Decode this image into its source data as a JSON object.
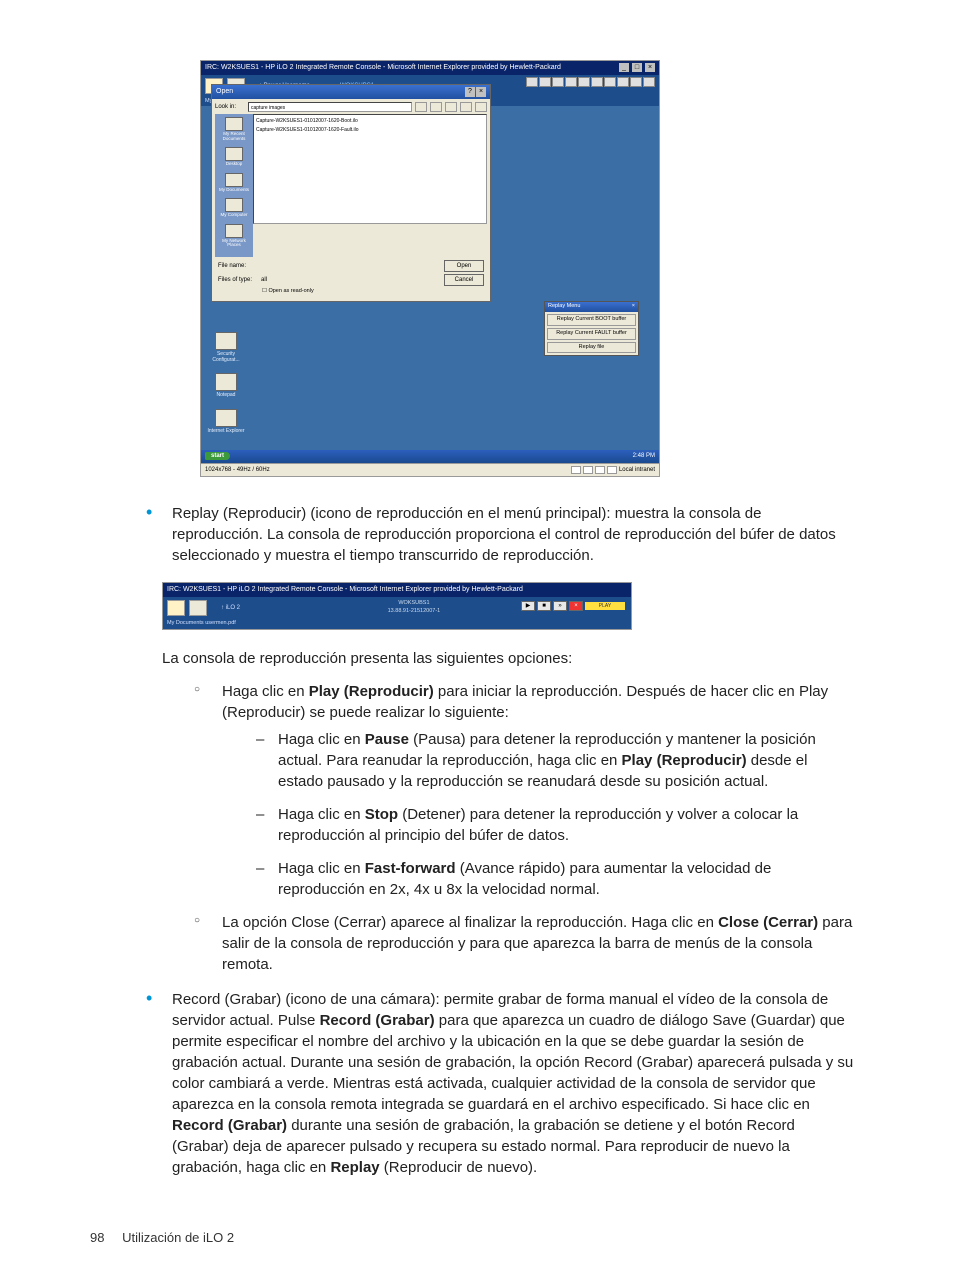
{
  "shot1": {
    "titlebar": "IRC: W2KSUES1 - HP iLO 2 Integrated Remote Console - Microsoft Internet Explorer provided by Hewlett-Packard",
    "toolbar_label": "WOKSUBS1",
    "toolbar_sub": "Power Username",
    "mydocs": "My Documents  usermen.pdf",
    "desktop_icons": [
      "Security Configurat...",
      "Notepad",
      "Internet Explorer"
    ],
    "open_dialog": {
      "title": "Open",
      "lookin_label": "Look in:",
      "lookin_value": "capture images",
      "files": [
        "Capture-W2KSUES1-01012007-1620-Boot.ilo",
        "Capture-W2KSUES1-01012007-1620-Fault.ilo"
      ],
      "places": [
        "My Recent Documents",
        "Desktop",
        "My Documents",
        "My Computer",
        "My Network Places"
      ],
      "filename_label": "File name:",
      "filename_value": "",
      "filetype_label": "Files of type:",
      "filetype_value": "all",
      "readonly": "Open as read-only",
      "open_btn": "Open",
      "cancel_btn": "Cancel"
    },
    "replay_menu": {
      "title": "Replay Menu",
      "items": [
        "Replay Current BOOT buffer",
        "Replay Current FAULT buffer",
        "Replay file"
      ]
    },
    "taskbar": {
      "start": "start",
      "right": "2:48 PM"
    },
    "status": {
      "left": "1024x768 - 49Hz / 60Hz",
      "right": "Local intranet"
    }
  },
  "bullets": {
    "replay": {
      "pre": "Replay (Reproducir) (icono de reproducción en el menú principal): muestra la consola de reproducción. La consola de reproducción proporciona el control de reproducción del búfer de datos seleccionado y muestra el tiempo transcurrido de reproducción."
    },
    "record": {
      "t1": "Record (Grabar) (icono de una cámara): permite grabar de forma manual el vídeo de la consola de servidor actual. Pulse ",
      "b1": "Record (Grabar)",
      "t2": " para que aparezca un cuadro de diálogo Save (Guardar) que permite especificar el nombre del archivo y la ubicación en la que se debe guardar la sesión de grabación actual. Durante una sesión de grabación, la opción Record (Grabar) aparecerá pulsada y su color cambiará a verde. Mientras está activada, cualquier actividad de la consola de servidor que aparezca en la consola remota integrada se guardará en el archivo especificado. Si hace clic en ",
      "b2": "Record (Grabar)",
      "t3": " durante una sesión de grabación, la grabación se detiene y el botón Record (Grabar) deja de aparecer pulsado y recupera su estado normal. Para reproducir de nuevo la grabación, haga clic en ",
      "b3": "Replay",
      "t4": " (Reproducir de nuevo)."
    }
  },
  "shot2": {
    "titlebar": "IRC: W2KSUES1 - HP iLO 2 Integrated Remote Console - Microsoft Internet Explorer provided by Hewlett-Packard",
    "label1": "WOKSUBS1",
    "label2": "13.88.91-21512007-1",
    "mydocs": "My Documents  usermen.pdf",
    "time": "PLAY"
  },
  "subintro": "La consola de reproducción presenta las siguientes opciones:",
  "circle1": {
    "t1": "Haga clic en ",
    "b1": "Play (Reproducir)",
    "t2": " para iniciar la reproducción. Después de hacer clic en Play (Reproducir) se puede realizar lo siguiente:"
  },
  "dash": {
    "d1": {
      "t1": "Haga clic en ",
      "b1": "Pause",
      "t2": " (Pausa) para detener la reproducción y mantener la posición actual. Para reanudar la reproducción, haga clic en ",
      "b2": "Play (Reproducir)",
      "t3": " desde el estado pausado y la reproducción se reanudará desde su posición actual."
    },
    "d2": {
      "t1": "Haga clic en ",
      "b1": "Stop",
      "t2": " (Detener) para detener la reproducción y volver a colocar la reproducción al principio del búfer de datos."
    },
    "d3": {
      "t1": "Haga clic en ",
      "b1": "Fast-forward",
      "t2": " (Avance rápido) para aumentar la velocidad de reproducción en 2x, 4x u 8x la velocidad normal."
    }
  },
  "circle2": {
    "t1": "La opción Close (Cerrar) aparece al finalizar la reproducción. Haga clic en ",
    "b1": "Close (Cerrar)",
    "t2": " para salir de la consola de reproducción y para que aparezca la barra de menús de la consola remota."
  },
  "footer": {
    "page": "98",
    "section": "Utilización de iLO 2"
  }
}
